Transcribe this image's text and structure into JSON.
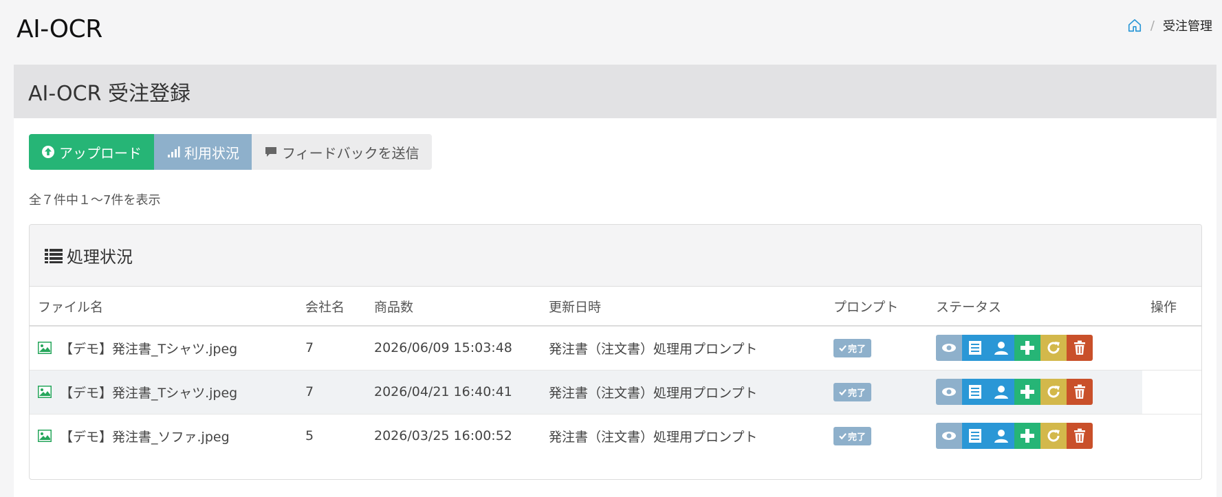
{
  "app": {
    "title": "AI-OCR"
  },
  "breadcrumb": {
    "home_icon": "home-icon",
    "separator": "/",
    "current": "受注管理"
  },
  "panel": {
    "title": "AI-OCR 受注登録"
  },
  "toolbar": {
    "upload_label": "アップロード",
    "usage_label": "利用状況",
    "feedback_label": "フィードバックを送信"
  },
  "summary": {
    "count_text": "全７件中１～7件を表示"
  },
  "card": {
    "title": "処理状況"
  },
  "table": {
    "headers": {
      "file": "ファイル名",
      "company": "会社名",
      "items": "商品数",
      "updated": "更新日時",
      "prompt": "プロンプト",
      "status": "ステータス",
      "ops": "操作"
    },
    "rows": [
      {
        "file": "【デモ】発注書_Tシャツ.jpeg",
        "company": "7",
        "updated": "2026/06/09 15:03:48",
        "prompt": "発注書（注文書）処理用プロンプト",
        "status": "完了"
      },
      {
        "file": "【デモ】発注書_Tシャツ.jpeg",
        "company": "7",
        "updated": "2026/04/21 16:40:41",
        "prompt": "発注書（注文書）処理用プロンプト",
        "status": "完了"
      },
      {
        "file": "【デモ】発注書_ソファ.jpeg",
        "company": "5",
        "updated": "2026/03/25 16:00:52",
        "prompt": "発注書（注文書）処理用プロンプト",
        "status": "完了"
      }
    ]
  },
  "colors": {
    "upload": "#26b576",
    "usage": "#8eb0cb",
    "view": "#8eb0cb",
    "detail": "#2a97d6",
    "add": "#26b576",
    "refresh": "#d3b84b",
    "delete": "#c9502a"
  }
}
